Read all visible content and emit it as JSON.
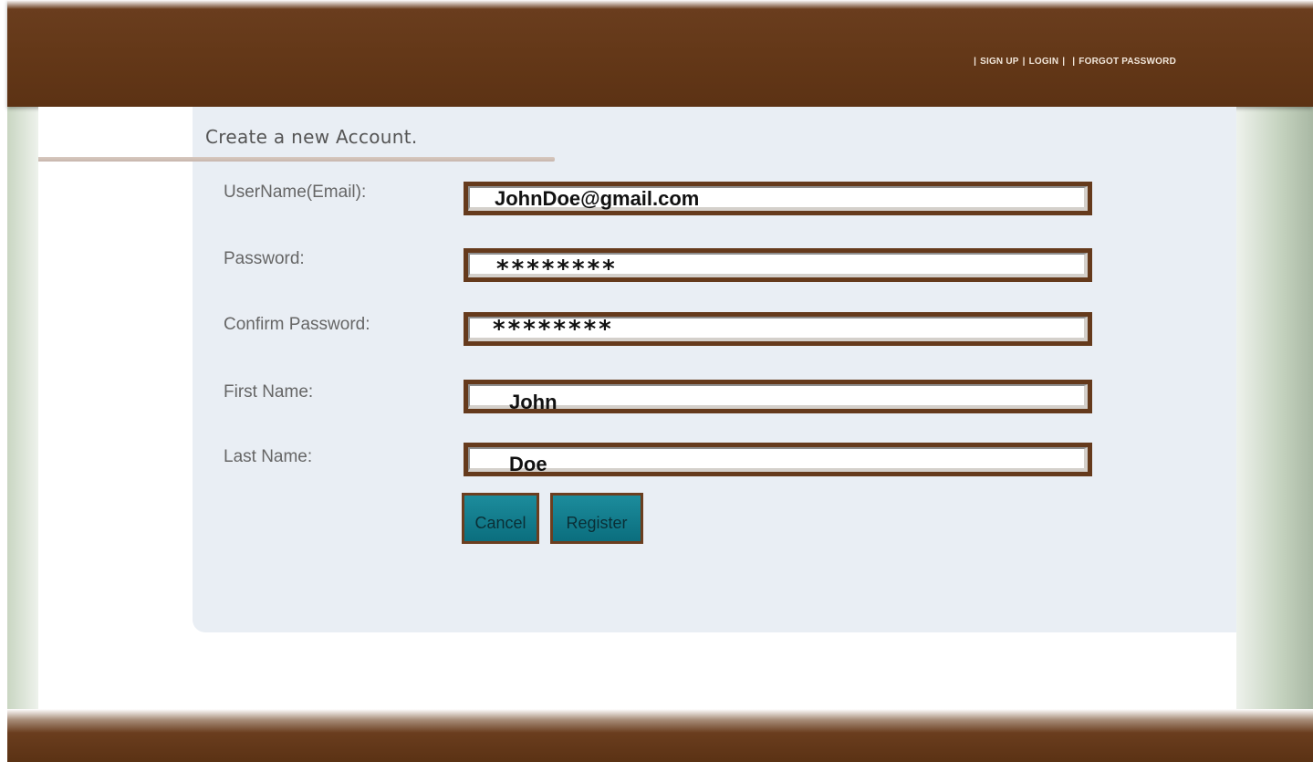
{
  "topnav": {
    "signup": "SIGN UP",
    "login": "LOGIN",
    "forgot": "FORGOT PASSWORD",
    "separator": "|"
  },
  "form": {
    "title": "Create a new Account.",
    "fields": [
      {
        "label": "UserName(Email):",
        "value": "JohnDoe@gmail.com"
      },
      {
        "label": "Password:",
        "value": "********"
      },
      {
        "label": "Confirm Password:",
        "value": "********"
      },
      {
        "label": "First Name:",
        "value": "John"
      },
      {
        "label": "Last Name:",
        "value": "Doe"
      }
    ],
    "cancel_label": "Cancel",
    "register_label": "Register"
  },
  "colors": {
    "header_brown": "#643818",
    "field_border": "#653a1c",
    "button_teal": "#137d8d",
    "panel_bg": "#e9eef4"
  }
}
